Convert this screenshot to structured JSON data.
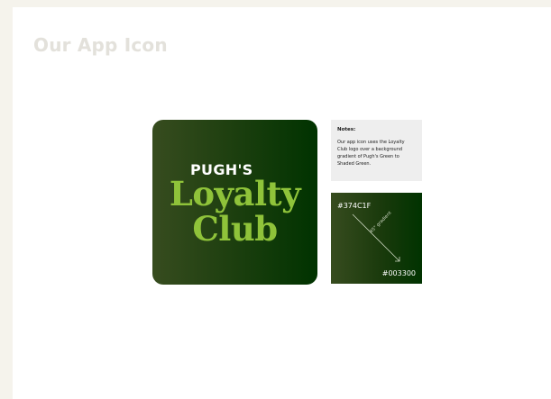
{
  "page": {
    "title": "Our App Icon"
  },
  "app_icon": {
    "brand_name": "PUGH'S",
    "line1": "Loyalty",
    "line2": "Club"
  },
  "notes": {
    "heading": "Notes:",
    "body": "Our app icon uses the Loyalty Club logo over a background gradient of Pugh's Green to Shaded Green."
  },
  "swatch": {
    "start_hex": "#374C1F",
    "end_hex": "#003300",
    "direction_label": "45° gradient"
  },
  "colors": {
    "pughs_green": "#374C1F",
    "shaded_green": "#003300",
    "logo_green": "#8FC33A",
    "background": "#F5F3EC"
  }
}
